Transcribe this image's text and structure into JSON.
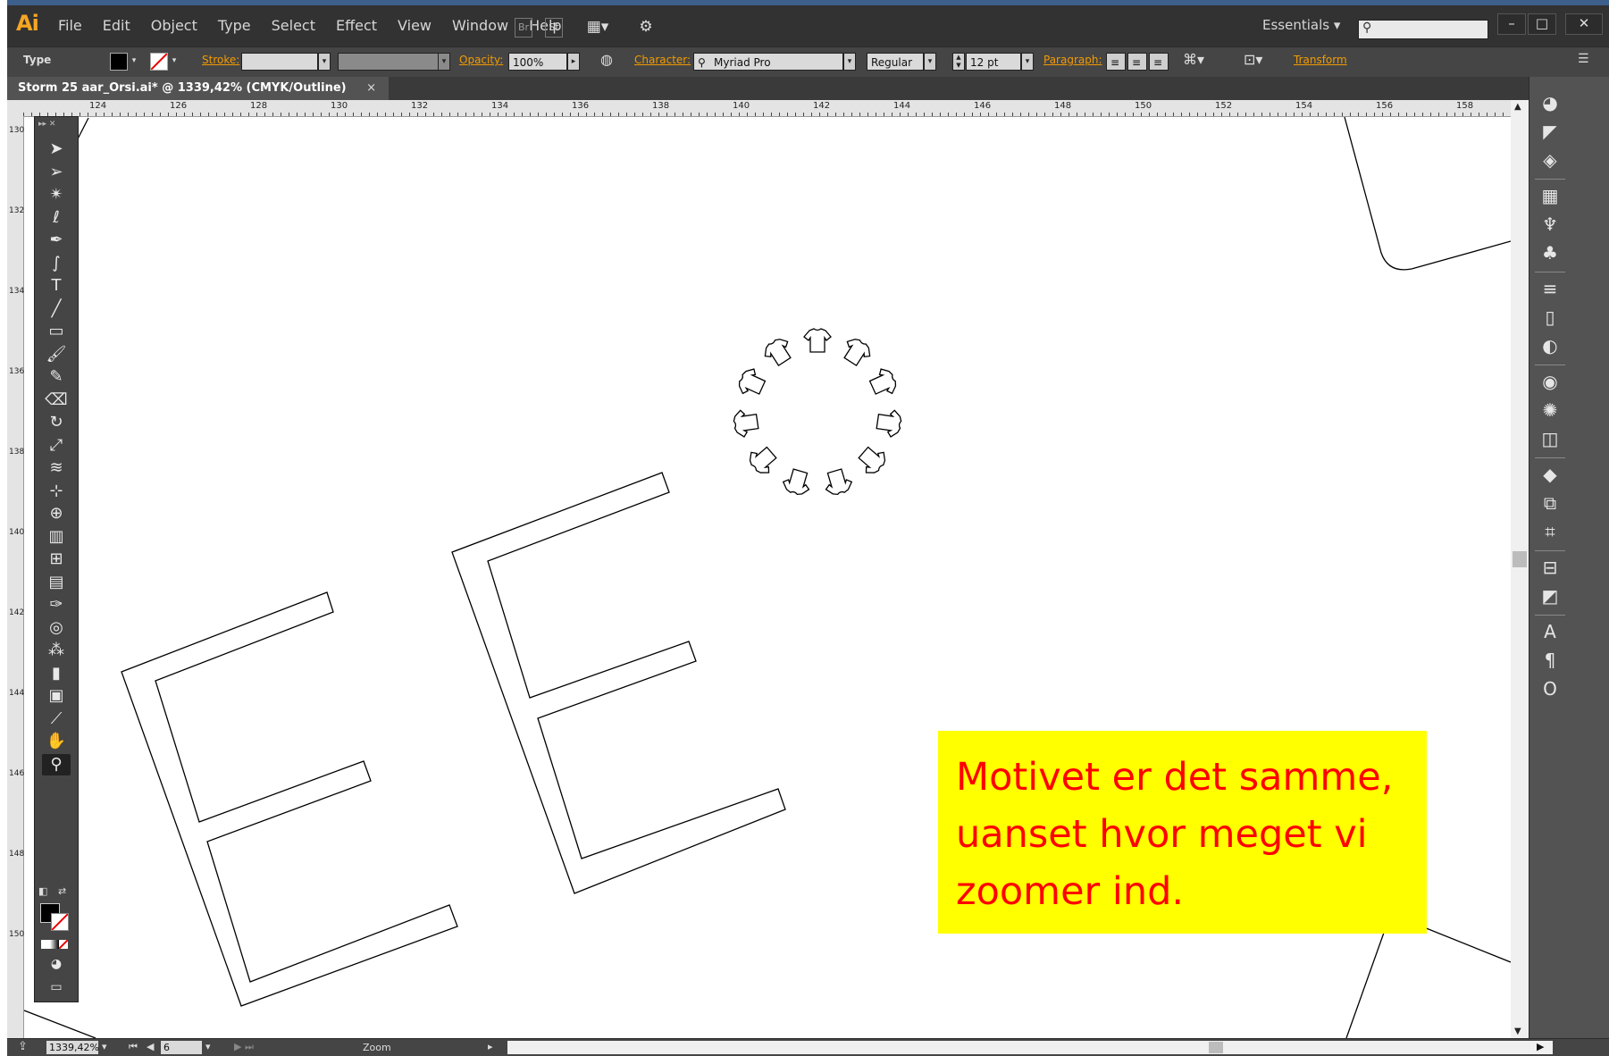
{
  "app": {
    "logo": "Ai"
  },
  "menu": [
    "File",
    "Edit",
    "Object",
    "Type",
    "Select",
    "Effect",
    "View",
    "Window",
    "Help"
  ],
  "menubar_icons": {
    "bridge": "Br",
    "stock": "St"
  },
  "workspace": "Essentials",
  "window_controls": {
    "minimize": "–",
    "maximize": "□",
    "close": "✕"
  },
  "control_bar": {
    "selection_label": "Type",
    "stroke_label": "Stroke:",
    "opacity_label": "Opacity:",
    "opacity_value": "100%",
    "character_label": "Character:",
    "font_family": "Myriad Pro",
    "font_style": "Regular",
    "font_size": "12 pt",
    "paragraph_label": "Paragraph:",
    "transform_label": "Transform"
  },
  "document_tab": {
    "title": "Storm 25 aar_Orsi.ai* @ 1339,42% (CMYK/Outline)",
    "close": "×"
  },
  "ruler": {
    "h_labels": [
      "124",
      "126",
      "128",
      "130",
      "132",
      "134",
      "136",
      "138",
      "140",
      "142",
      "144",
      "146",
      "148",
      "150",
      "152",
      "154",
      "156",
      "158"
    ],
    "v_labels": [
      "130",
      "132",
      "134",
      "136",
      "138",
      "140",
      "142",
      "144",
      "146",
      "148",
      "150"
    ]
  },
  "status_bar": {
    "zoom": "1339,42%",
    "page": "6",
    "tool_name": "Zoom"
  },
  "annotation": {
    "lines": [
      "Motivet er det samme,",
      "uanset hvor meget vi",
      "zoomer ind."
    ],
    "background": "#ffff00",
    "text_color": "#ff0000"
  },
  "tools": [
    "selection-icon",
    "direct-selection-icon",
    "magic-wand-icon",
    "lasso-icon",
    "pen-icon",
    "curvature-icon",
    "type-icon",
    "line-icon",
    "rectangle-icon",
    "paintbrush-icon",
    "blob-brush-icon",
    "eraser-icon",
    "rotate-icon",
    "scale-icon",
    "width-icon",
    "free-transform-icon",
    "shape-builder-icon",
    "perspective-grid-icon",
    "mesh-icon",
    "gradient-icon",
    "eyedropper-icon",
    "blend-icon",
    "symbol-sprayer-icon",
    "column-graph-icon",
    "artboard-icon",
    "slice-icon",
    "hand-icon",
    "zoom-icon"
  ],
  "panel_icons": [
    "color-icon",
    "color-guide-icon",
    "navigator-icon",
    "swatches-icon",
    "brushes-icon",
    "symbols-icon",
    "stroke-icon",
    "gradient-panel-icon",
    "transparency-icon",
    "libraries-icon",
    "appearance-icon",
    "graphic-styles-icon",
    "layers-icon",
    "artboards-panel-icon",
    "transform-panel-icon",
    "align-icon",
    "pathfinder-icon",
    "character-icon",
    "paragraph-icon",
    "opentype-icon"
  ]
}
